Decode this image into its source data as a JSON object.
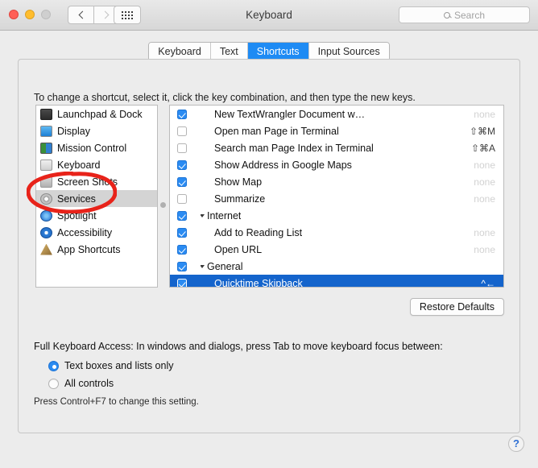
{
  "window": {
    "title": "Keyboard"
  },
  "titlebar": {
    "back_icon": "chevron-left-icon",
    "forward_icon": "chevron-right-icon",
    "grid_icon": "show-all-grid-icon",
    "lights": [
      "close",
      "minimize",
      "zoom"
    ]
  },
  "search": {
    "placeholder": "Search",
    "value": "",
    "icon": "search-icon"
  },
  "tabs": [
    {
      "label": "Keyboard",
      "selected": false
    },
    {
      "label": "Text",
      "selected": false
    },
    {
      "label": "Shortcuts",
      "selected": true
    },
    {
      "label": "Input Sources",
      "selected": false
    }
  ],
  "instruction": "To change a shortcut, select it, click the key combination, and then type the new keys.",
  "sidebar": {
    "items": [
      {
        "label": "Launchpad & Dock",
        "icon": "launchpad-dock-icon",
        "selected": false
      },
      {
        "label": "Display",
        "icon": "display-icon",
        "selected": false
      },
      {
        "label": "Mission Control",
        "icon": "mission-control-icon",
        "selected": false
      },
      {
        "label": "Keyboard",
        "icon": "keyboard-icon",
        "selected": false
      },
      {
        "label": "Screen Shots",
        "icon": "screenshots-icon",
        "selected": false
      },
      {
        "label": "Services",
        "icon": "services-gear-icon",
        "selected": true
      },
      {
        "label": "Spotlight",
        "icon": "spotlight-icon",
        "selected": false
      },
      {
        "label": "Accessibility",
        "icon": "accessibility-icon",
        "selected": false
      },
      {
        "label": "App Shortcuts",
        "icon": "app-shortcuts-icon",
        "selected": false
      }
    ]
  },
  "shortcuts": {
    "rows": [
      {
        "label": "New TextWrangler Document w…",
        "shortcut": "none",
        "checked": true,
        "kind": "item",
        "selected": false
      },
      {
        "label": "Open man Page in Terminal",
        "shortcut": "⇧⌘M",
        "checked": false,
        "kind": "item",
        "selected": false
      },
      {
        "label": "Search man Page Index in Terminal",
        "shortcut": "⇧⌘A",
        "checked": false,
        "kind": "item",
        "selected": false
      },
      {
        "label": "Show Address in Google Maps",
        "shortcut": "none",
        "checked": true,
        "kind": "item",
        "selected": false
      },
      {
        "label": "Show Map",
        "shortcut": "none",
        "checked": true,
        "kind": "item",
        "selected": false
      },
      {
        "label": "Summarize",
        "shortcut": "none",
        "checked": false,
        "kind": "item",
        "selected": false
      },
      {
        "label": "Internet",
        "shortcut": "",
        "checked": true,
        "kind": "group",
        "selected": false
      },
      {
        "label": "Add to Reading List",
        "shortcut": "none",
        "checked": true,
        "kind": "item",
        "selected": false
      },
      {
        "label": "Open URL",
        "shortcut": "none",
        "checked": true,
        "kind": "item",
        "selected": false
      },
      {
        "label": "General",
        "shortcut": "",
        "checked": true,
        "kind": "group",
        "selected": false
      },
      {
        "label": "Quicktime Skipback",
        "shortcut": "^←",
        "checked": true,
        "kind": "item",
        "selected": true
      }
    ]
  },
  "buttons": {
    "restore_defaults": "Restore Defaults",
    "help": "?"
  },
  "full_keyboard_access": {
    "title": "Full Keyboard Access: In windows and dialogs, press Tab to move keyboard focus between:",
    "options": [
      {
        "label": "Text boxes and lists only",
        "selected": true
      },
      {
        "label": "All controls",
        "selected": false
      }
    ],
    "hint": "Press Control+F7 to change this setting."
  },
  "annotation": {
    "shape": "red-ellipse",
    "target": "Services",
    "color": "#e8231a"
  }
}
